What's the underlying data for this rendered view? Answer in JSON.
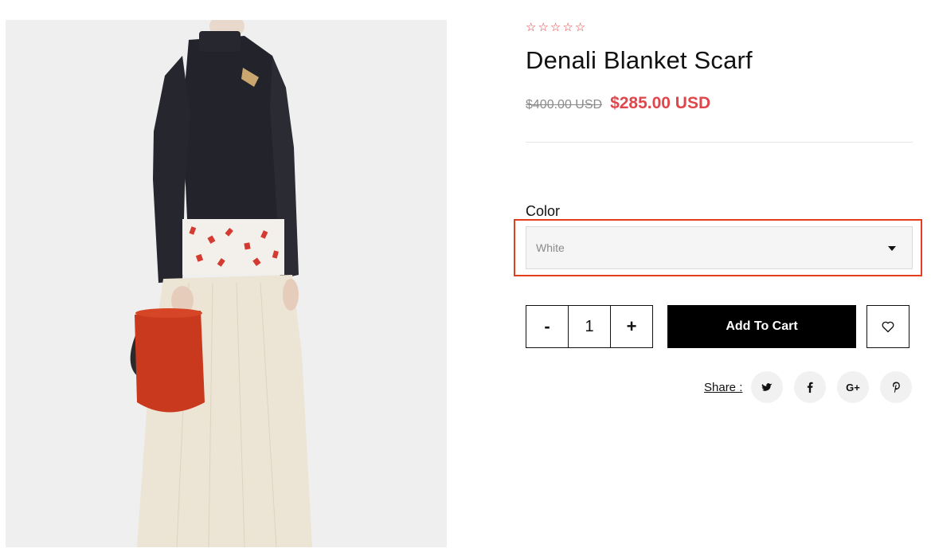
{
  "product": {
    "rating_stars": [
      "☆",
      "☆",
      "☆",
      "☆",
      "☆"
    ],
    "title": "Denali Blanket Scarf",
    "price_old": "$400.00 USD",
    "price_new": "$285.00 USD",
    "image_icon": "product-photo"
  },
  "options": {
    "color_label": "Color",
    "color_selected": "White"
  },
  "purchase": {
    "qty_minus": "-",
    "qty_value": "1",
    "qty_plus": "+",
    "add_to_cart": "Add To Cart",
    "wishlist_icon": "heart-icon"
  },
  "share": {
    "label": "Share :",
    "twitter_icon": "twitter-icon",
    "facebook_icon": "facebook-icon",
    "google_plus_label": "G+",
    "pinterest_icon": "pinterest-icon"
  },
  "colors": {
    "accent_red": "#e0474c",
    "highlight_border": "#e53d1e",
    "button_black": "#000000"
  }
}
